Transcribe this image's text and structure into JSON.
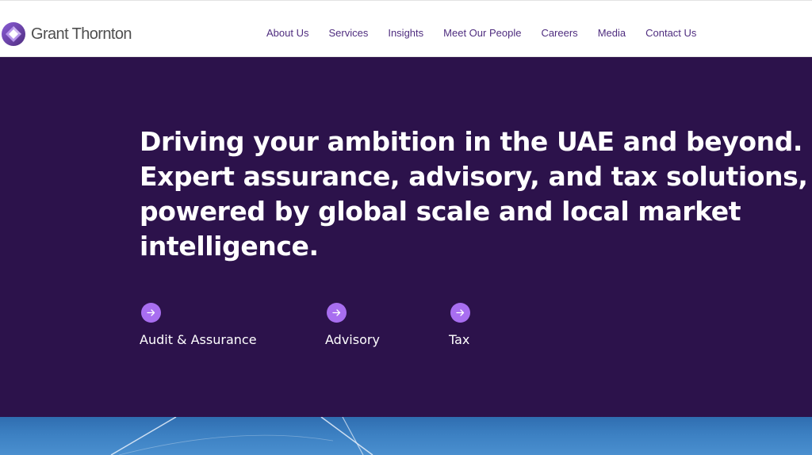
{
  "brand": {
    "name": "Grant Thornton",
    "logo_icon": "grant-thornton-logo-icon"
  },
  "nav": {
    "items": [
      {
        "label": "About Us"
      },
      {
        "label": "Services"
      },
      {
        "label": "Insights"
      },
      {
        "label": "Meet Our People"
      },
      {
        "label": "Careers"
      },
      {
        "label": "Media"
      },
      {
        "label": "Contact Us"
      }
    ]
  },
  "hero": {
    "headline": "Driving your ambition in the UAE and beyond. Expert assurance, advisory, and tax solutions, powered by global scale and local market intelligence.",
    "services": [
      {
        "label": "Audit & Assurance",
        "icon": "arrow-right-icon"
      },
      {
        "label": "Advisory",
        "icon": "arrow-right-icon"
      },
      {
        "label": "Tax",
        "icon": "arrow-right-icon"
      }
    ]
  },
  "colors": {
    "brand_purple": "#4f2d7f",
    "hero_background": "#2c124b",
    "accent_purple": "#a86ef0",
    "photo_sky": "#3c80c2"
  }
}
